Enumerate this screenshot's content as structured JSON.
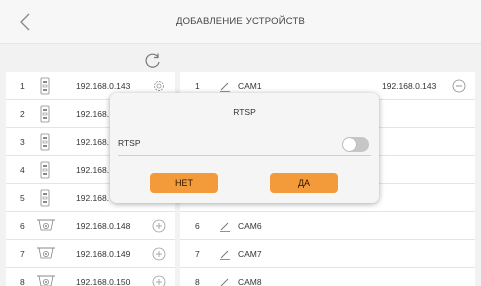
{
  "header": {
    "title": "ДОБАВЛЕНИЕ УСТРОЙСТВ",
    "back_icon": "chevron-left-icon"
  },
  "refresh_icon": "refresh-icon",
  "left_list": [
    {
      "index": "1",
      "ip": "192.168.0.143",
      "device": "door-station-icon",
      "action": "gear-icon"
    },
    {
      "index": "2",
      "ip": "192.168.",
      "device": "door-station-icon",
      "action": ""
    },
    {
      "index": "3",
      "ip": "192.168.",
      "device": "door-station-icon",
      "action": ""
    },
    {
      "index": "4",
      "ip": "192.168.",
      "device": "door-station-icon",
      "action": ""
    },
    {
      "index": "5",
      "ip": "192.168.",
      "device": "door-station-icon",
      "action": ""
    },
    {
      "index": "6",
      "ip": "192.168.0.148",
      "device": "camera-icon",
      "action": "plus-icon"
    },
    {
      "index": "7",
      "ip": "192.168.0.149",
      "device": "camera-icon",
      "action": "plus-icon"
    },
    {
      "index": "8",
      "ip": "192.168.0.150",
      "device": "camera-icon",
      "action": "plus-icon"
    }
  ],
  "right_list": [
    {
      "index": "1",
      "name": "CAM1",
      "ip": "192.168.0.143",
      "action": "minus-icon"
    },
    {
      "index": "6",
      "name": "CAM6",
      "ip": "",
      "action": ""
    },
    {
      "index": "7",
      "name": "CAM7",
      "ip": "",
      "action": ""
    },
    {
      "index": "8",
      "name": "CAM8",
      "ip": "",
      "action": ""
    }
  ],
  "dialog": {
    "title": "RTSP",
    "label": "RTSP",
    "toggle_on": false,
    "no_label": "НЕТ",
    "yes_label": "ДА"
  },
  "colors": {
    "accent": "#f39b3a",
    "toggle_off": "#c6c6c6"
  }
}
